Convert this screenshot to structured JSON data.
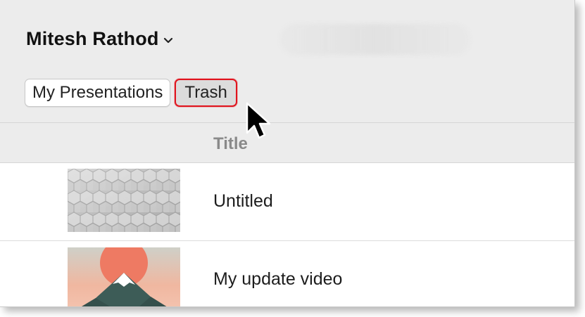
{
  "header": {
    "account_name": "Mitesh Rathod",
    "account_chevron_icon": "chevron-down-icon"
  },
  "tabs": [
    {
      "label": "My Presentations",
      "selected": false
    },
    {
      "label": "Trash",
      "selected": true,
      "highlight_color": "#e0141e"
    }
  ],
  "table": {
    "column_header": "Title",
    "rows": [
      {
        "title": "Untitled",
        "thumbnail": "gray-hexagon-pattern"
      },
      {
        "title": "My update video",
        "thumbnail": "red-sun-mountain-illustration"
      }
    ]
  },
  "colors": {
    "header_bg": "#ececec",
    "highlight": "#e0141e"
  },
  "cursor": "arrow-pointer-icon"
}
